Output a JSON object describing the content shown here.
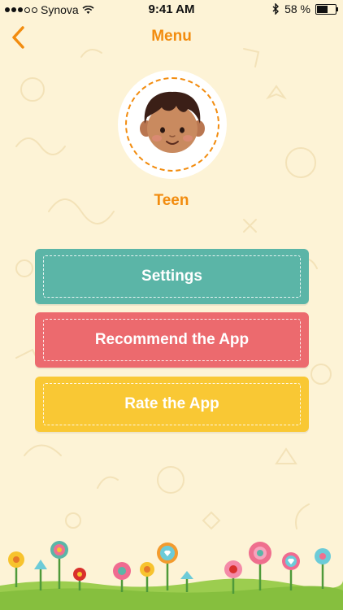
{
  "status_bar": {
    "carrier": "Synova",
    "time": "9:41 AM",
    "battery": "58 %",
    "battery_level": 0.58
  },
  "nav": {
    "title": "Menu"
  },
  "profile": {
    "name": "Teen"
  },
  "menu": {
    "settings_label": "Settings",
    "recommend_label": "Recommend the App",
    "rate_label": "Rate the App"
  },
  "colors": {
    "accent": "#f28c0f",
    "background": "#fdf3d6",
    "settings": "#5bb5a7",
    "recommend": "#ec6a6e",
    "rate": "#f9c834"
  },
  "icons": {
    "back": "chevron-left-icon",
    "wifi": "wifi-icon",
    "bluetooth": "bluetooth-icon",
    "battery": "battery-icon"
  }
}
